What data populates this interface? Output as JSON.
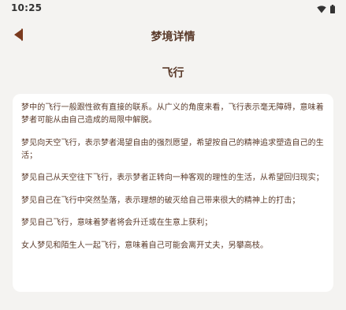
{
  "status_bar": {
    "time": "10:25",
    "wifi_icon": "wifi-icon",
    "battery_icon": "battery-icon"
  },
  "header": {
    "back_icon": "back-arrow-icon",
    "title": "梦境详情"
  },
  "dream": {
    "title": "飞行",
    "paragraphs": [
      "梦中的飞行一般跟性欲有直接的联系。从广义的角度来看，飞行表示毫无障碍，意味着梦者可能从由自己造成的局限中解脱。",
      "梦见向天空飞行，表示梦者渴望自由的强烈愿望，希望按自己的精神追求塑造自己的生活；",
      "梦见自己从天空往下飞行，表示梦者正转向一种客观的理性的生活，从希望回归现实；",
      "梦见自己在飞行中突然坠落，表示理想的破灭给自己带来很大的精神上的打击；",
      "梦见自己飞行，意味着梦者将会升迁或在生意上获利；",
      "女人梦见和陌生人一起飞行，意味着自己可能会离开丈夫，另攀高枝。"
    ]
  },
  "colors": {
    "background": "#f4f3f1",
    "card": "#ffffff",
    "text": "#5a3a2a",
    "icon": "#7a3a1e"
  }
}
